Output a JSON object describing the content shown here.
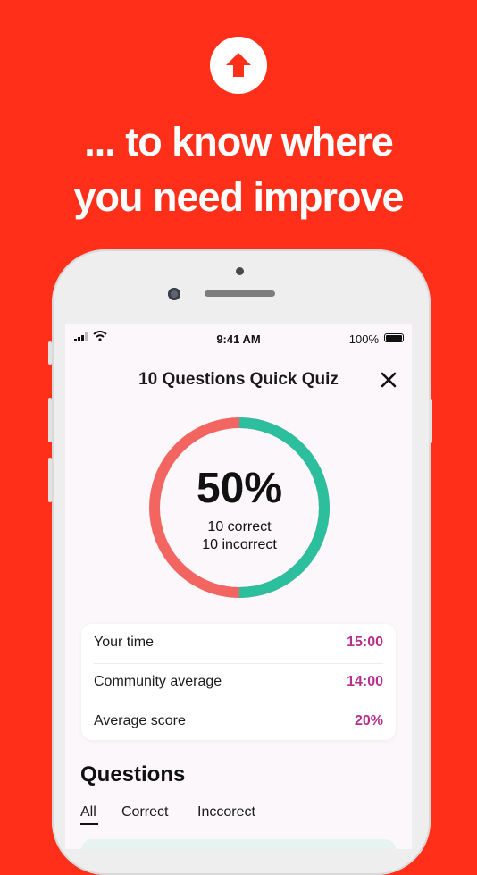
{
  "promo": {
    "headline_line1": "... to know where",
    "headline_line2": "you need improve",
    "badge_icon": "arrow-up-icon"
  },
  "status_bar": {
    "time": "9:41 AM",
    "battery_percent": "100%"
  },
  "quiz": {
    "title": "10 Questions Quick Quiz",
    "close_icon": "close-icon"
  },
  "result": {
    "percentage": "50%",
    "correct_text": "10 correct",
    "incorrect_text": "10 incorrect",
    "correct_fraction": 0.5,
    "correct_color": "#2CBF9E",
    "incorrect_color": "#F26560"
  },
  "stats": [
    {
      "label": "Your time",
      "value": "15:00"
    },
    {
      "label": "Community average",
      "value": "14:00"
    },
    {
      "label": "Average score",
      "value": "20%"
    }
  ],
  "questions": {
    "heading": "Questions",
    "tabs": [
      "All",
      "Correct",
      "Inccorect"
    ],
    "active_tab": "All"
  },
  "colors": {
    "background": "#FF2F1A",
    "accent_value": "#B52F8B",
    "screen_bg": "#FBF7FA"
  }
}
